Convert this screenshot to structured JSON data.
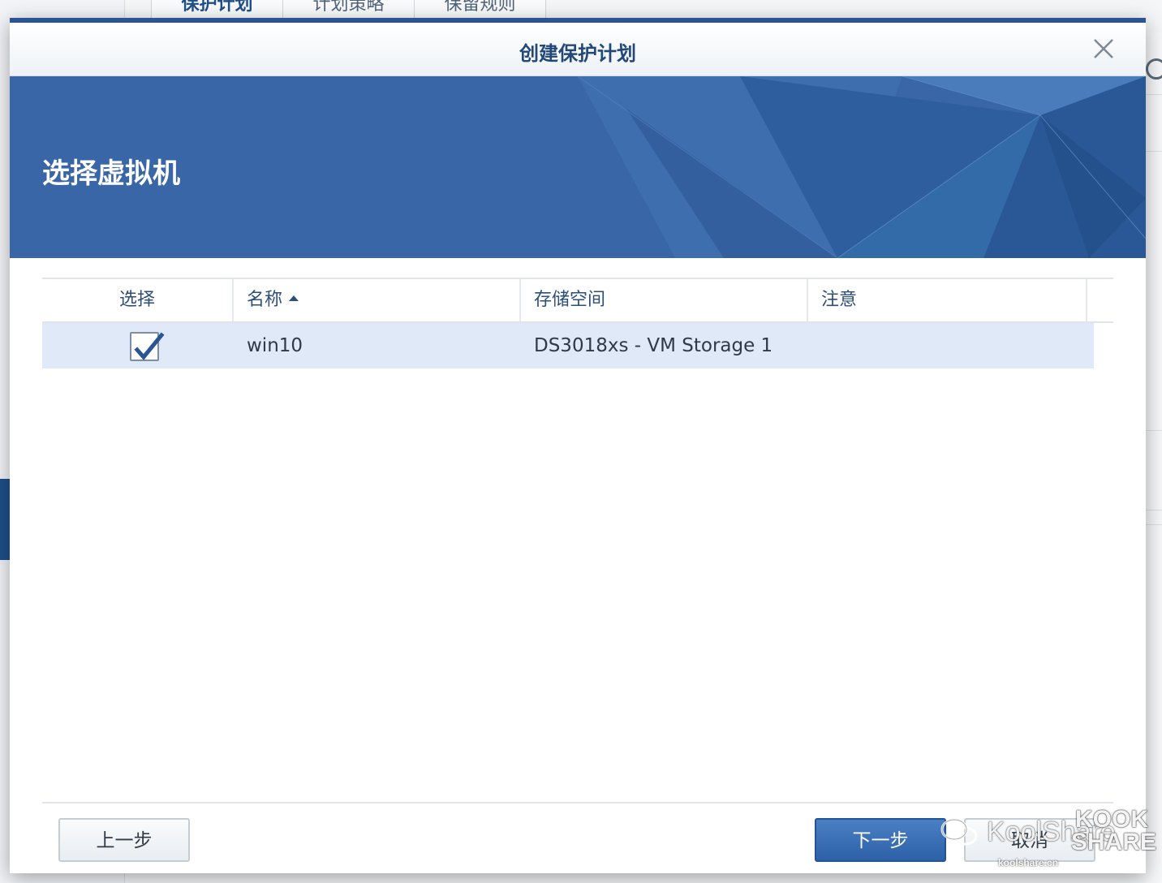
{
  "background": {
    "tabs": [
      "保护计划",
      "计划策略",
      "保留规则"
    ],
    "active_tab_index": 0
  },
  "dialog": {
    "title": "创建保护计划",
    "banner_title": "选择虚拟机",
    "close_icon": "close-icon"
  },
  "table": {
    "columns": [
      "选择",
      "名称",
      "存储空间",
      "注意"
    ],
    "sorted_column": "名称",
    "sort_direction": "ascending",
    "rows": [
      {
        "selected": true,
        "name": "win10",
        "storage": "DS3018xs - VM Storage 1",
        "note": ""
      }
    ]
  },
  "footer": {
    "prev_label": "上一步",
    "next_label": "下一步",
    "cancel_label": "取消"
  },
  "watermark": {
    "text": "KoolShare",
    "domain": "koolshare.cn",
    "logo_top": "KOOK",
    "logo_bottom": "SHARE"
  },
  "colors": {
    "accent": "#2e62a8",
    "banner": "#3866a6",
    "title_text": "#22487a",
    "selected_row": "#dfe9f7"
  }
}
